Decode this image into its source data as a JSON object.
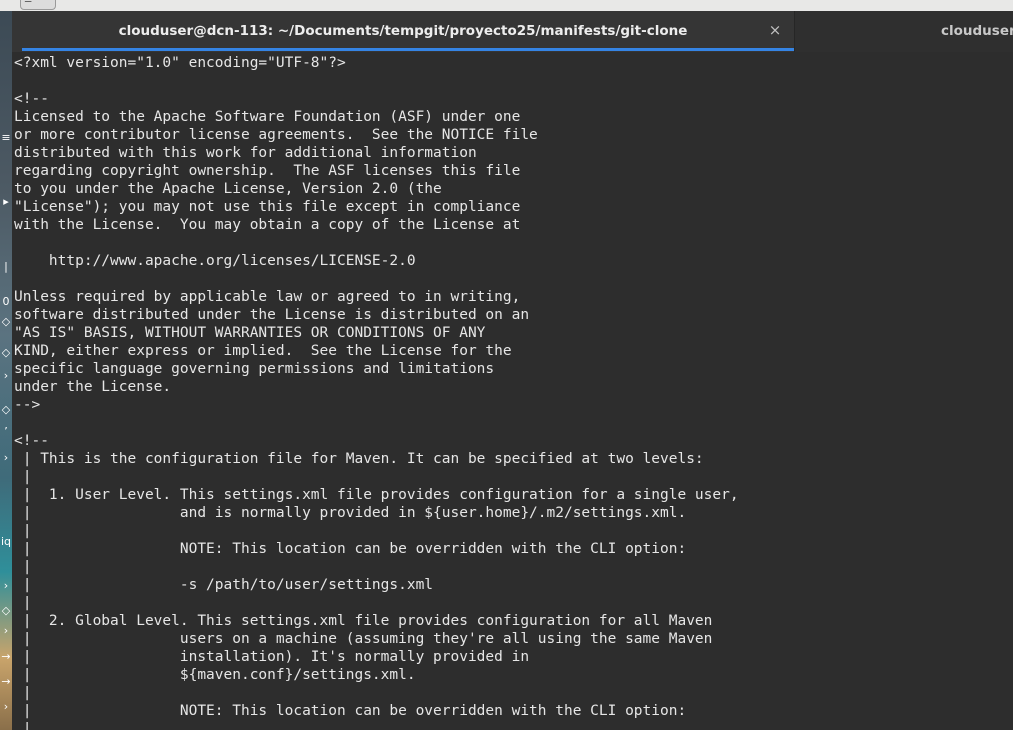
{
  "top_bar": {
    "button_glyph": "☰"
  },
  "desktop_strip": {
    "glyphs": [
      "E",
      "≡",
      "▸",
      "|",
      "0",
      "◇",
      "◇",
      "›",
      "◇",
      "’",
      "›",
      "iq",
      "›",
      "◇",
      "›",
      "→",
      "→",
      "›"
    ]
  },
  "tabs": [
    {
      "title": "clouduser@dcn-113: ~/Documents/tempgit/proyecto25/manifests/git-clone",
      "close_icon": "×"
    },
    {
      "title": "clouduser@"
    }
  ],
  "terminal": {
    "lines": [
      "<?xml version=\"1.0\" encoding=\"UTF-8\"?>",
      "",
      "<!--",
      "Licensed to the Apache Software Foundation (ASF) under one",
      "or more contributor license agreements.  See the NOTICE file",
      "distributed with this work for additional information",
      "regarding copyright ownership.  The ASF licenses this file",
      "to you under the Apache License, Version 2.0 (the",
      "\"License\"); you may not use this file except in compliance",
      "with the License.  You may obtain a copy of the License at",
      "",
      "    http://www.apache.org/licenses/LICENSE-2.0",
      "",
      "Unless required by applicable law or agreed to in writing,",
      "software distributed under the License is distributed on an",
      "\"AS IS\" BASIS, WITHOUT WARRANTIES OR CONDITIONS OF ANY",
      "KIND, either express or implied.  See the License for the",
      "specific language governing permissions and limitations",
      "under the License.",
      "-->",
      "",
      "<!--",
      " | This is the configuration file for Maven. It can be specified at two levels:",
      " |",
      " |  1. User Level. This settings.xml file provides configuration for a single user,",
      " |                 and is normally provided in ${user.home}/.m2/settings.xml.",
      " |",
      " |                 NOTE: This location can be overridden with the CLI option:",
      " |",
      " |                 -s /path/to/user/settings.xml",
      " |",
      " |  2. Global Level. This settings.xml file provides configuration for all Maven",
      " |                 users on a machine (assuming they're all using the same Maven",
      " |                 installation). It's normally provided in",
      " |                 ${maven.conf}/settings.xml.",
      " |",
      " |                 NOTE: This location can be overridden with the CLI option:",
      " |"
    ]
  }
}
